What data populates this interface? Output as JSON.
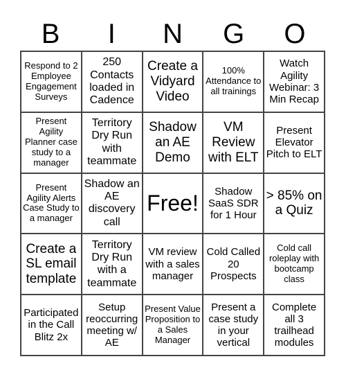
{
  "header": [
    "B",
    "I",
    "N",
    "G",
    "O"
  ],
  "cells": [
    "Respond to 2 Employee Engagement Surveys",
    "250 Contacts loaded in Cadence",
    "Create a Vidyard Video",
    "100% Attendance to all trainings",
    "Watch Agility Webinar: 3 Min Recap",
    "Present Agility Planner case study to a manager",
    "Territory Dry Run with teammate",
    "Shadow an AE Demo",
    "VM Review with ELT",
    "Present Elevator Pitch to ELT",
    "Present Agility Alerts Case Study to a manager",
    "Shadow an AE discovery call",
    "Free!",
    "Shadow SaaS SDR for 1 Hour",
    "> 85% on a Quiz",
    "Create a SL email template",
    "Territory Dry Run with a teammate",
    "VM review with a sales manager",
    "Cold Called 20 Prospects",
    "Cold call roleplay with bootcamp class",
    "Participated in the Call Blitz 2x",
    "Setup reoccurring meeting w/ AE",
    "Present Value Proposition to a Sales Manager",
    "Present a case study in your vertical",
    "Complete all 3 trailhead modules"
  ]
}
